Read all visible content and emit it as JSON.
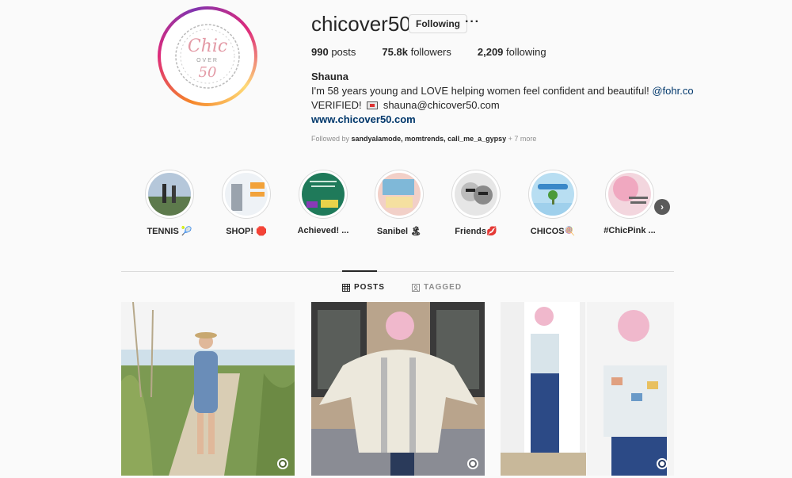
{
  "profile": {
    "username": "chicover50",
    "follow_label": "Following",
    "more_label": "···",
    "logo_text": "Chic",
    "logo_sub": "OVER",
    "logo_num": "50",
    "stats": {
      "posts_count": "990",
      "posts_label": "posts",
      "followers_count": "75.8k",
      "followers_label": "followers",
      "following_count": "2,209",
      "following_label": "following"
    },
    "full_name": "Shauna",
    "bio_line1": "I'm 58 years young and LOVE helping women feel confident and beautiful!",
    "bio_mention": "@fohr.co",
    "bio_line2_prefix": "VERIFIED!",
    "bio_email": "shauna@chicover50.com",
    "website": "www.chicover50.com",
    "followed_by_prefix": "Followed by",
    "followed_by_names": "sandyalamode, momtrends, call_me_a_gypsy",
    "followed_by_suffix": "+ 7 more"
  },
  "highlights": [
    {
      "label": "TENNIS 🎾",
      "colors": [
        "#8aa0b8",
        "#4a6a3a"
      ]
    },
    {
      "label": "SHOP! 🛑",
      "colors": [
        "#e8eef5",
        "#f2a23a"
      ]
    },
    {
      "label": "Achieved! ...",
      "colors": [
        "#1f7a5a",
        "#e8d24a"
      ]
    },
    {
      "label": "Sanibel 🏝",
      "colors": [
        "#f2d0c8",
        "#7fb8d8"
      ]
    },
    {
      "label": "Friends💋",
      "colors": [
        "#d8d8d8",
        "#5a5a5a"
      ]
    },
    {
      "label": "CHICOS🍭",
      "colors": [
        "#9fd0ec",
        "#3a88c8"
      ]
    },
    {
      "label": "#ChicPink ...",
      "colors": [
        "#f0b8c8",
        "#e890b0"
      ]
    }
  ],
  "tabs": {
    "posts": "POSTS",
    "tagged": "TAGGED"
  },
  "posts": [
    {
      "alt": "beach"
    },
    {
      "alt": "sweater"
    },
    {
      "alt": "jeans"
    }
  ]
}
